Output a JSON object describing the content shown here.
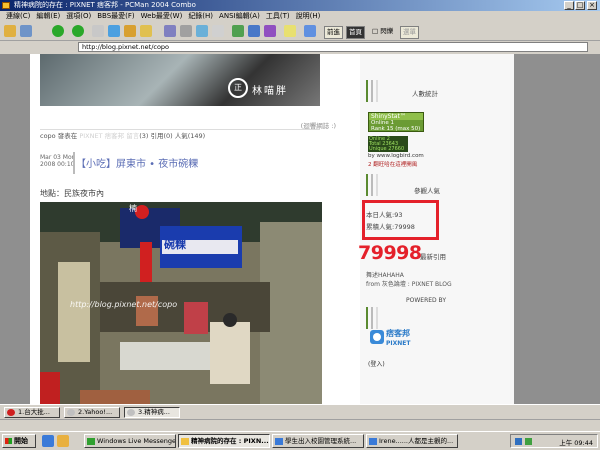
{
  "window": {
    "title": "精神病院的存在 : PIXNET 痞客邦 - PCMan 2004 Combo"
  },
  "menu": [
    "連線(C)",
    "編輯(E)",
    "選項(O)",
    "BBS最愛(F)",
    "Web最愛(W)",
    "紀錄(H)",
    "ANSI編輯(A)",
    "工具(T)",
    "說明(H)"
  ],
  "toolbar": {
    "btn_front": "前進",
    "btn_back_home": "首頁",
    "chk_block": "□ 閃爍",
    "btn_dropdown": "選單"
  },
  "address": {
    "label": "",
    "url": "http://blog.pixnet.net/copo"
  },
  "banner": {
    "stamp": "正",
    "text": "林喵胖"
  },
  "post": {
    "comments_link": "(迴響網誌 :)",
    "meta_author": "copo 發表在",
    "meta_link1": "PIXNET 痞客邦",
    "meta_sep": "留言",
    "meta_counts": "(3) 引用(0) 人氣(149)",
    "date_month": "Mar 03 Mon",
    "date_year": "2008 00:10",
    "title": "【小吃】屏東市 • 夜市碗粿",
    "location": "地點：民族夜市內"
  },
  "photo": {
    "sign1": "碗粿",
    "sign_red": "楠",
    "watermark": "http://blog.pixnet.net/copo"
  },
  "sidebar": {
    "stats_title": "人數統計",
    "badge_title": "ShinyStat™",
    "badge_online": "Online",
    "badge_online_val": "1",
    "badge_rank": "Rank",
    "badge_rank_val": "15 (max 50)",
    "badge2_line1": "Online 2",
    "badge2_line2": "Total 23643",
    "badge2_line3": "Unique 27660",
    "by": "by www.logbird.com",
    "map_link": "2 翻旺哈在這裡開風",
    "popularity_title": "參觀人氣",
    "today": "本日人氣:93",
    "total": "累積人氣:79998",
    "big_count": "79998",
    "ref_title": "最新引用",
    "ref_item1": "舞述HAHAHA",
    "ref_item2": "from 灰色論壇 : PIXNET BLOG",
    "powered_by": "POWERED BY",
    "logo_cn": "痞客邦",
    "logo_en": "PIXNET",
    "login": "(登入)"
  },
  "tabs": [
    {
      "label": "1.台大批..."
    },
    {
      "label": "2.Yahoo!..."
    },
    {
      "label": "3.精神病..."
    }
  ],
  "taskbar": {
    "start": "開始",
    "tasks": [
      {
        "label": "Windows Live Messenger"
      },
      {
        "label": "精神病院的存在 : PIXN..."
      },
      {
        "label": "學生出入校園管理系統..."
      },
      {
        "label": "Irene......人都是主觀的..."
      }
    ],
    "clock": "上午 09:44"
  },
  "colors": {
    "accent_red": "#e4202a",
    "title_blue": "#0a246a",
    "link_blue": "#5b6db5"
  }
}
